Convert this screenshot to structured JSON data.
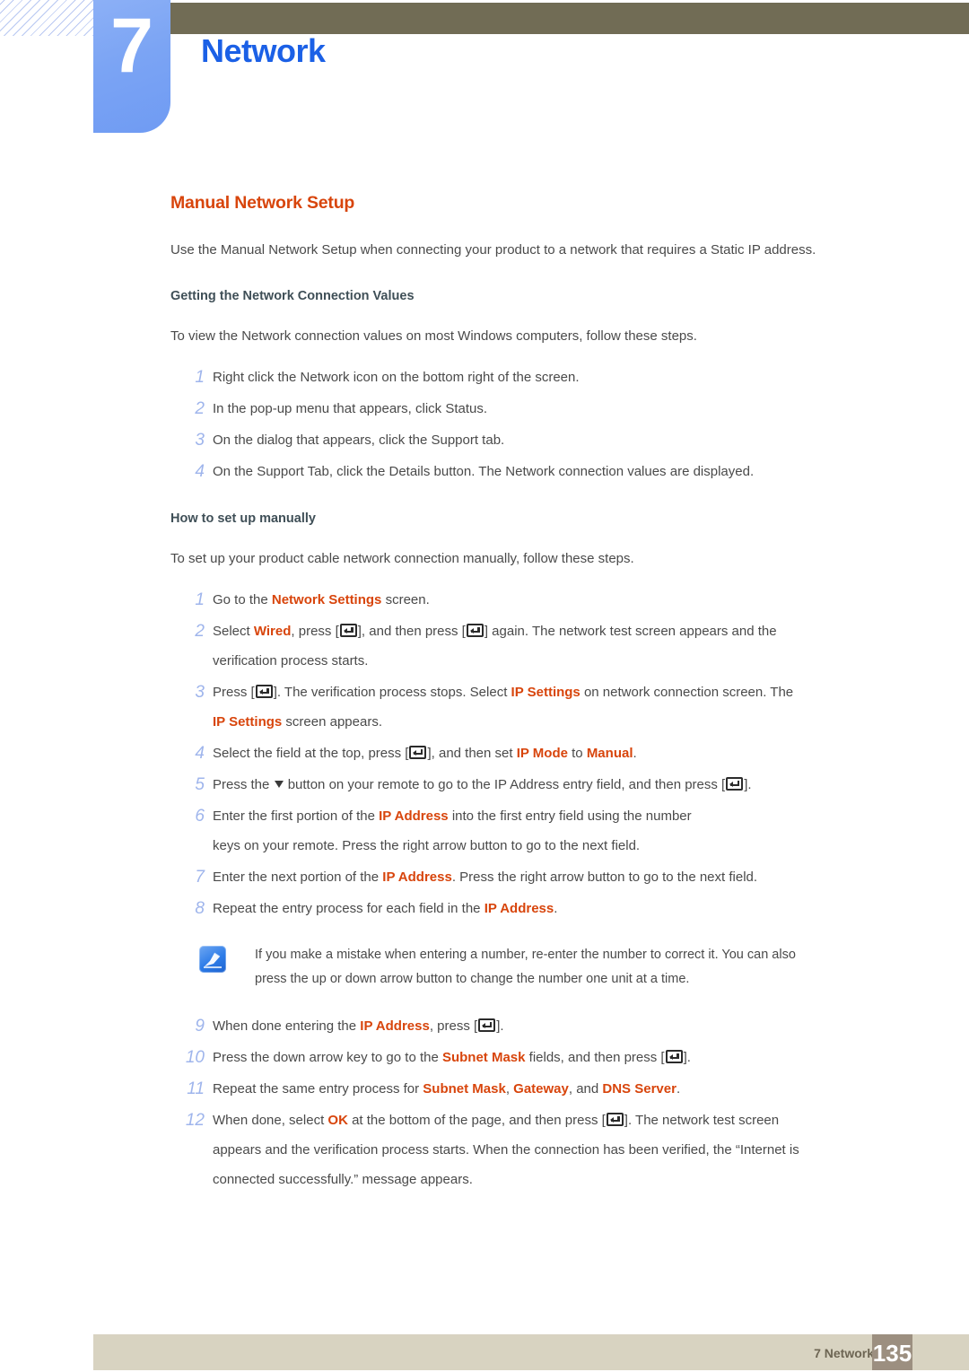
{
  "colors": {
    "heading_orange": "#d8450c",
    "chapter_blue": "#1b60e6",
    "badge_blue": "#7ba4f4",
    "step_number": "#9fb5ec",
    "olive_bar": "#716c55",
    "footer_bar": "#d8d3c1",
    "page_box": "#9c8f80",
    "body_text": "#4a4a4a",
    "subheading": "#3f4f57"
  },
  "chapter": {
    "number": "7",
    "title": "Network"
  },
  "main": {
    "heading": "Manual Network Setup",
    "intro": "Use the Manual Network Setup when connecting your product to a network that requires a Static IP address.",
    "section1": {
      "heading": "Getting the Network Connection Values",
      "intro": "To view the Network connection values on most Windows computers, follow these steps.",
      "steps": [
        {
          "num": "1",
          "text": "Right click the Network icon on the bottom right of the screen."
        },
        {
          "num": "2",
          "text": "In the pop-up menu that appears, click Status."
        },
        {
          "num": "3",
          "text": "On the dialog that appears, click the Support tab."
        },
        {
          "num": "4",
          "text": "On the Support Tab, click the Details button. The Network connection values are displayed."
        }
      ]
    },
    "section2": {
      "heading": "How to set up manually",
      "intro": "To set up your product cable network connection manually, follow these steps.",
      "steps": [
        {
          "num": "1",
          "parts": [
            "Go to the ",
            "Network Settings",
            " screen."
          ]
        },
        {
          "num": "2",
          "parts": [
            "Select ",
            "Wired",
            ", press [",
            "ENTER",
            "], and then press [",
            "ENTER",
            "] again. The network test screen appears and the"
          ],
          "cont": "verification process starts."
        },
        {
          "num": "3",
          "parts": [
            "Press [",
            "ENTER",
            "]. The verification process stops. Select ",
            "IP Settings",
            " on network connection screen. The"
          ],
          "cont_parts": [
            "IP Settings",
            " screen appears."
          ]
        },
        {
          "num": "4",
          "parts": [
            "Select the field at the top, press [",
            "ENTER",
            "], and then set ",
            "IP Mode",
            " to ",
            "Manual",
            "."
          ]
        },
        {
          "num": "5",
          "parts": [
            "Press the ",
            "DOWN",
            " button on your remote to go to the IP Address entry field, and then press [",
            "ENTER",
            "]."
          ]
        },
        {
          "num": "6",
          "parts": [
            "Enter the first portion of the ",
            "IP Address",
            " into the first entry field using the number"
          ],
          "cont": "keys on your remote. Press the right arrow button to go to the next field."
        },
        {
          "num": "7",
          "parts": [
            "Enter the next portion of the ",
            "IP Address",
            ". Press the right arrow button to go to the next field."
          ]
        },
        {
          "num": "8",
          "parts": [
            "Repeat the entry process for each field in the ",
            "IP Address",
            "."
          ]
        },
        {
          "num": "9",
          "parts": [
            "When done entering the ",
            "IP Address",
            ", press [",
            "ENTER",
            "]."
          ]
        },
        {
          "num": "10",
          "parts": [
            "Press the down arrow key to go to the ",
            "Subnet Mask",
            " fields, and then press [",
            "ENTER",
            "]."
          ]
        },
        {
          "num": "11",
          "parts": [
            "Repeat the same entry process for ",
            "Subnet Mask",
            ", ",
            "Gateway",
            ", and ",
            "DNS Server",
            "."
          ]
        },
        {
          "num": "12",
          "parts": [
            "When done, select ",
            "OK",
            " at the bottom of the page, and then press [",
            "ENTER",
            "]. The network test screen"
          ],
          "cont": "appears and the verification process starts. When the connection has been verified, the “Internet is",
          "cont2": "connected successfully.” message appears."
        }
      ],
      "note": {
        "icon": "note-pencil-icon",
        "line1": "If you make a mistake when entering a number, re-enter the number to correct it. You can also",
        "line2": "press the up or down arrow button to change the number one unit at a time."
      }
    }
  },
  "footer": {
    "label": "7 Network",
    "page": "135"
  }
}
